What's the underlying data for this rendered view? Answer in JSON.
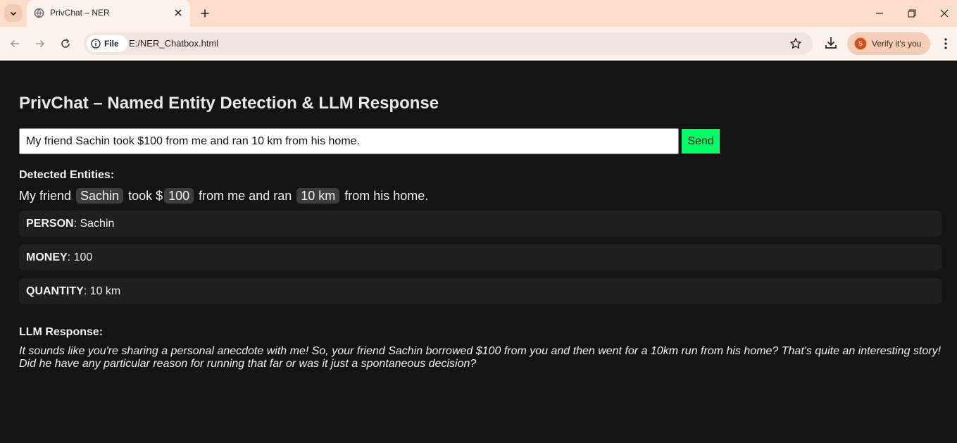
{
  "browser": {
    "tab_title": "PrivChat – NER",
    "site_chip": "File",
    "url": "E:/NER_Chatbox.html",
    "profile_initial": "S",
    "verify_label": "Verify it's you"
  },
  "page": {
    "title": "PrivChat – Named Entity Detection & LLM Response",
    "input_value": "My friend Sachin took $100 from me and ran 10 km from his home.",
    "send_label": "Send",
    "detected_label": "Detected Entities:",
    "sentence": {
      "t1": "My friend ",
      "e1": "Sachin",
      "t2": " took $",
      "e2": "100",
      "t3": " from me and ran ",
      "e3": "10 km",
      "t4": " from his home."
    },
    "entities": [
      {
        "type": "PERSON",
        "value": ": Sachin"
      },
      {
        "type": "MONEY",
        "value": ": 100"
      },
      {
        "type": "QUANTITY",
        "value": ": 10 km"
      }
    ],
    "llm_label": "LLM Response:",
    "llm_response": "It sounds like you're sharing a personal anecdote with me! So, your friend Sachin borrowed $100 from you and then went for a 10km run from his home? That's quite an interesting story! Did he have any particular reason for running that far or was it just a spontaneous decision?"
  },
  "colors": {
    "page_bg": "#141414",
    "send_button": "#00ff66",
    "entity_card": "#1f1f1f",
    "entity_highlight": "#3d3d3d",
    "chrome_titlebar": "#fcdccb"
  }
}
